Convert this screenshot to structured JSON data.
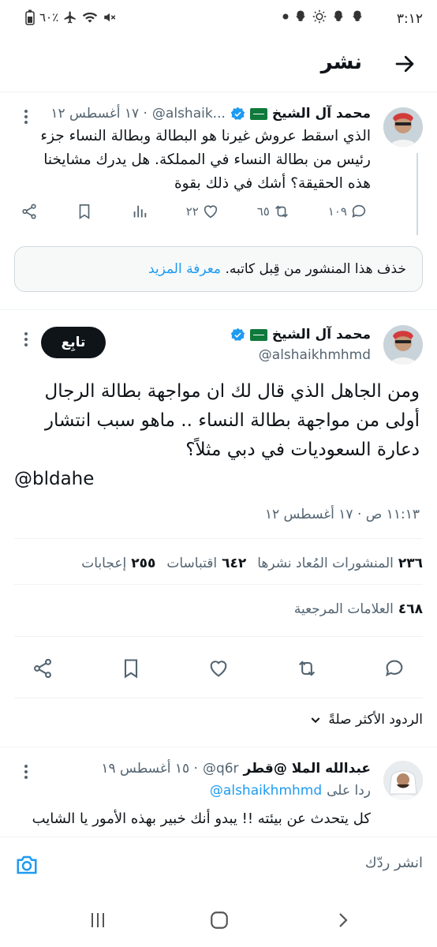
{
  "status_bar": {
    "time": "٣:١٢",
    "battery_pct": "٦٠٪",
    "icons": [
      "snapchat-icon",
      "snapchat-icon",
      "brightness-icon",
      "snapchat-icon",
      "dot-icon",
      "mute-icon",
      "wifi-icon",
      "airplane-icon",
      "battery-icon"
    ]
  },
  "header": {
    "title": "نشر"
  },
  "parent_tweet": {
    "name": "محمد آل الشيخ",
    "handle": "@alshaik...",
    "date": "· ١٧ أغسطس ١٢",
    "text": "الذي اسقط عروش غيرنا هو البطالة وبطالة النساء جزء رئيس من بطالة النساء في المملكة. هل يدرك مشايخنا هذه الحقيقة؟ أشك في ذلك بقوة",
    "replies": "١٠٩",
    "retweets": "٦٥",
    "likes": "٢٢"
  },
  "notice": {
    "text": "خذف هذا المنشور من قِبل كاتبه.",
    "link": "معرفة المزيد"
  },
  "main_tweet": {
    "name": "محمد آل الشيخ",
    "handle": "@alshaikhmhmd",
    "follow_label": "تابِع",
    "text": "ومن الجاهل الذي قال لك ان مواجهة بطالة الرجال أولى من مواجهة بطالة النساء .. ماهو سبب انتشار دعارة السعوديات في دبي مثلاً؟",
    "mention": "@bldahe",
    "timestamp": "١١:١٣ ص · ١٧ أغسطس ١٢"
  },
  "stats": {
    "reposts_num": "٢٣٦",
    "reposts_label": "المنشورات المُعاد نشرها",
    "quotes_num": "٦٤٢",
    "quotes_label": "اقتباسات",
    "likes_num": "٢٥٥",
    "likes_label": "إعجابات",
    "bookmarks_num": "٤٦٨",
    "bookmarks_label": "العلامات المرجعية"
  },
  "replies_sort": {
    "label": "الردود الأكثر صلةً"
  },
  "reply_tweet": {
    "name": "عبدالله الملا @قطر",
    "handle": "@q6r",
    "date": "· ١٥ أغسطس ١٩",
    "reply_to_label": "ردا على",
    "reply_to_handle": "@alshaikhmhmd",
    "text": "كل يتحدث عن بيئته !! يبدو أنك خبير بهذه الأمور يا الشايب"
  },
  "composer": {
    "placeholder": "انشر ردّك"
  },
  "colors": {
    "accent": "#1d9bf0",
    "text": "#0f1419",
    "muted": "#536471",
    "border": "#eff3f4"
  }
}
